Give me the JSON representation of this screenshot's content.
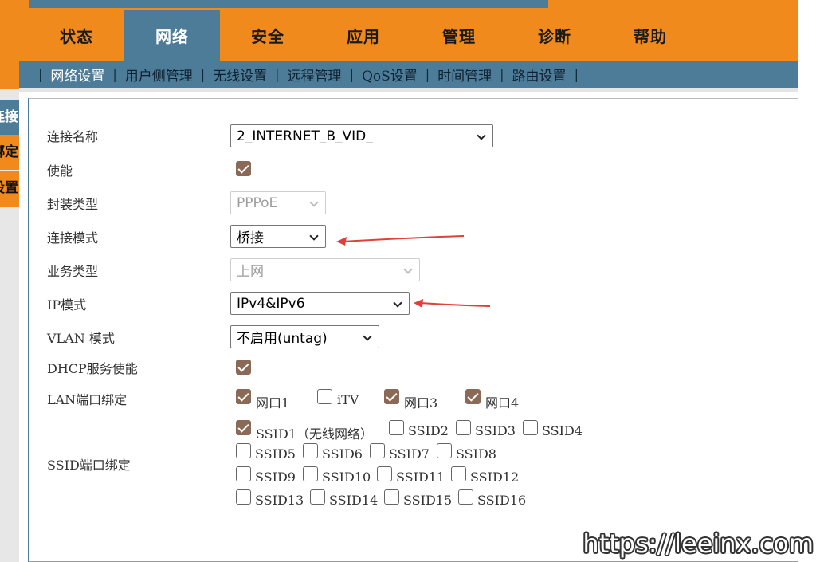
{
  "main_nav": [
    "状态",
    "网络",
    "安全",
    "应用",
    "管理",
    "诊断",
    "帮助"
  ],
  "sub_nav": [
    "网络设置",
    "用户侧管理",
    "无线设置",
    "远程管理",
    "QoS设置",
    "时间管理",
    "路由设置"
  ],
  "sub_sep": "|",
  "side_nav": [
    "连接",
    "绑定",
    "设置"
  ],
  "form": {
    "connection_name": {
      "label": "连接名称",
      "value": "2_INTERNET_B_VID_"
    },
    "enable": {
      "label": "使能",
      "checked": true
    },
    "encap_type": {
      "label": "封装类型",
      "value": "PPPoE"
    },
    "connection_mode": {
      "label": "连接模式",
      "value": "桥接"
    },
    "service_type": {
      "label": "业务类型",
      "value": "上网"
    },
    "ip_mode": {
      "label": "IP模式",
      "value": "IPv4&IPv6"
    },
    "vlan_mode": {
      "label": "VLAN 模式",
      "value": "不启用(untag)"
    },
    "dhcp": {
      "label": "DHCP服务使能",
      "checked": true
    },
    "lan_binding": {
      "label": "LAN端口绑定",
      "ports": [
        {
          "name": "网口1",
          "checked": true
        },
        {
          "name": "iTV",
          "checked": false
        },
        {
          "name": "网口3",
          "checked": true
        },
        {
          "name": "网口4",
          "checked": true
        }
      ]
    },
    "ssid_binding": {
      "label": "SSID端口绑定",
      "ssids": [
        {
          "name": "SSID1（无线网络）",
          "checked": true
        },
        {
          "name": "SSID2",
          "checked": false
        },
        {
          "name": "SSID3",
          "checked": false
        },
        {
          "name": "SSID4",
          "checked": false
        },
        {
          "name": "SSID5",
          "checked": false
        },
        {
          "name": "SSID6",
          "checked": false
        },
        {
          "name": "SSID7",
          "checked": false
        },
        {
          "name": "SSID8",
          "checked": false
        },
        {
          "name": "SSID9",
          "checked": false
        },
        {
          "name": "SSID10",
          "checked": false
        },
        {
          "name": "SSID11",
          "checked": false
        },
        {
          "name": "SSID12",
          "checked": false
        },
        {
          "name": "SSID13",
          "checked": false
        },
        {
          "name": "SSID14",
          "checked": false
        },
        {
          "name": "SSID15",
          "checked": false
        },
        {
          "name": "SSID16",
          "checked": false
        }
      ]
    }
  },
  "watermark": "https://leeinx.com",
  "colors": {
    "orange": "#f08a1d",
    "blue": "#4d7c99",
    "checkbox": "#8a6a57",
    "arrow": "#e0403a"
  },
  "icons": [
    "chevron-down-icon",
    "checkmark-icon",
    "annotation-arrow-icon"
  ]
}
